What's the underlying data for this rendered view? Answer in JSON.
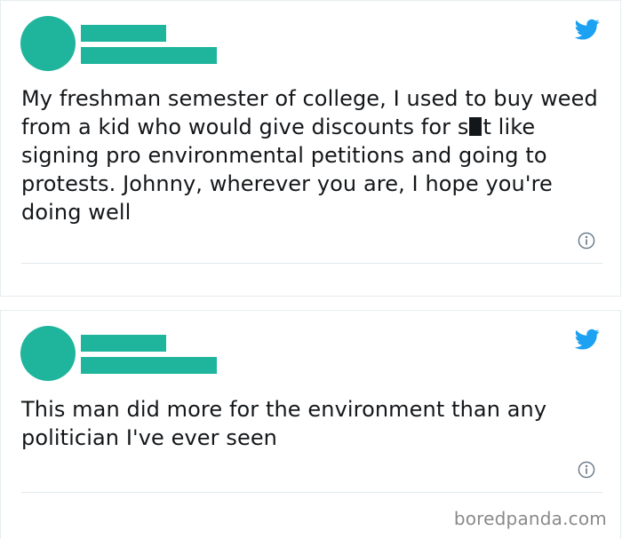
{
  "colors": {
    "placeholder": "#1fb59d",
    "twitter_blue": "#1da1f2",
    "text": "#14171a",
    "muted": "#8a8a8a"
  },
  "tweets": [
    {
      "text_before": "My freshman semester of college, I used to buy weed from a kid who would give discounts for s",
      "redacted": true,
      "text_after": "t like signing pro environmental petitions and going to protests. Johnny, wherever you are, I hope you're doing well",
      "icons": [
        "twitter-bird-icon",
        "info-icon"
      ]
    },
    {
      "text": "This man did more for the environment than any politician I've ever seen",
      "icons": [
        "twitter-bird-icon",
        "info-icon"
      ]
    }
  ],
  "watermark": "boredpanda.com"
}
